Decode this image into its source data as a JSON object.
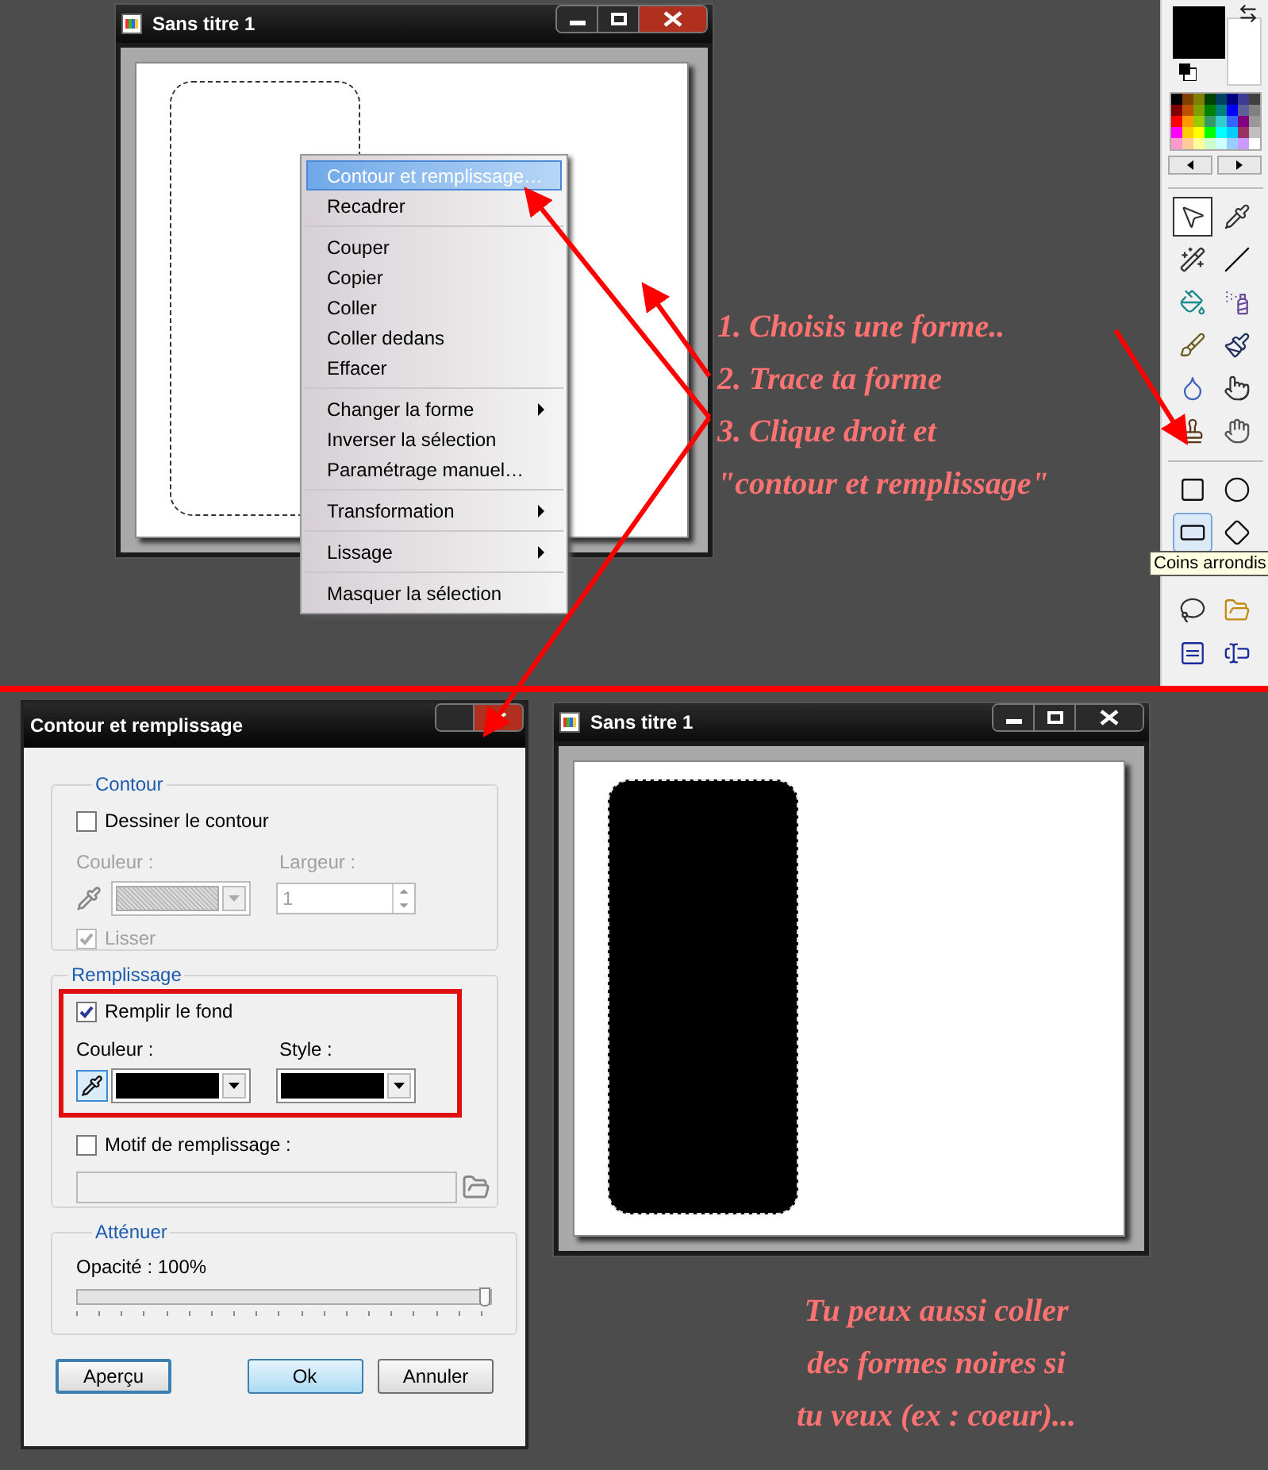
{
  "top_window": {
    "title": "Sans titre 1",
    "active": true,
    "selection_filled": false
  },
  "context_menu": [
    {
      "kind": "item",
      "label": "Contour et remplissage…",
      "selected": true,
      "submenu": false
    },
    {
      "kind": "item",
      "label": "Recadrer",
      "selected": false,
      "submenu": false
    },
    {
      "kind": "separator"
    },
    {
      "kind": "item",
      "label": "Couper",
      "selected": false,
      "submenu": false
    },
    {
      "kind": "item",
      "label": "Copier",
      "selected": false,
      "submenu": false
    },
    {
      "kind": "item",
      "label": "Coller",
      "selected": false,
      "submenu": false
    },
    {
      "kind": "item",
      "label": "Coller dedans",
      "selected": false,
      "submenu": false
    },
    {
      "kind": "item",
      "label": "Effacer",
      "selected": false,
      "submenu": false
    },
    {
      "kind": "separator"
    },
    {
      "kind": "item",
      "label": "Changer la forme",
      "selected": false,
      "submenu": true
    },
    {
      "kind": "item",
      "label": "Inverser la sélection",
      "selected": false,
      "submenu": false
    },
    {
      "kind": "item",
      "label": "Paramétrage manuel…",
      "selected": false,
      "submenu": false
    },
    {
      "kind": "separator"
    },
    {
      "kind": "item",
      "label": "Transformation",
      "selected": false,
      "submenu": true
    },
    {
      "kind": "separator"
    },
    {
      "kind": "item",
      "label": "Lissage",
      "selected": false,
      "submenu": true
    },
    {
      "kind": "separator"
    },
    {
      "kind": "item",
      "label": "Masquer la sélection",
      "selected": false,
      "submenu": false
    }
  ],
  "annotations": [
    "1. Choisis une forme..",
    "2. Trace ta forme",
    "3. Clique droit et",
    "\"contour et remplissage\""
  ],
  "toolbox": {
    "palette": [
      {
        "color": "#000000"
      },
      {
        "color": "#804000"
      },
      {
        "color": "#808000"
      },
      {
        "color": "#004000"
      },
      {
        "color": "#004060"
      },
      {
        "color": "#000080"
      },
      {
        "color": "#3c3c90"
      },
      {
        "color": "#404040"
      },
      {
        "color": "#800000"
      },
      {
        "color": "#c05000"
      },
      {
        "color": "#80a000"
      },
      {
        "color": "#008000"
      },
      {
        "color": "#008080"
      },
      {
        "color": "#0000ff"
      },
      {
        "color": "#606099"
      },
      {
        "color": "#808080"
      },
      {
        "color": "#ff0000"
      },
      {
        "color": "#ff9900"
      },
      {
        "color": "#99cc00"
      },
      {
        "color": "#339966"
      },
      {
        "color": "#33cccc"
      },
      {
        "color": "#3366ff"
      },
      {
        "color": "#800080"
      },
      {
        "color": "#999999"
      },
      {
        "color": "#ff00ff"
      },
      {
        "color": "#ffcc00"
      },
      {
        "color": "#ffff00"
      },
      {
        "color": "#00ff00"
      },
      {
        "color": "#00ffff"
      },
      {
        "color": "#00ccff"
      },
      {
        "color": "#993366"
      },
      {
        "color": "#c0c0c0"
      },
      {
        "color": "#ff99cc"
      },
      {
        "color": "#ffcc99"
      },
      {
        "color": "#ffff99"
      },
      {
        "color": "#ccffcc"
      },
      {
        "color": "#ccffff"
      },
      {
        "color": "#99ccff"
      },
      {
        "color": "#cc99ff"
      },
      {
        "color": "#ffffff"
      }
    ],
    "tools": [
      {
        "kind": "pointer",
        "selected": true
      },
      {
        "kind": "eyedropper",
        "selected": false
      },
      {
        "kind": "wand",
        "selected": false
      },
      {
        "kind": "line",
        "selected": false
      },
      {
        "kind": "bucket",
        "selected": false
      },
      {
        "kind": "spray",
        "selected": false
      },
      {
        "kind": "brush",
        "selected": false
      },
      {
        "kind": "brush2",
        "selected": false
      },
      {
        "kind": "drop",
        "selected": false
      },
      {
        "kind": "finger",
        "selected": false
      },
      {
        "kind": "stamp",
        "selected": false
      },
      {
        "kind": "hand",
        "selected": false
      }
    ],
    "shapes": [
      {
        "kind": "rectangle",
        "selected": false
      },
      {
        "kind": "ellipse",
        "selected": false
      },
      {
        "kind": "rounded",
        "selected": true
      },
      {
        "kind": "diamond",
        "selected": false
      },
      {
        "kind": "lasso",
        "selected": false
      },
      {
        "kind": "folder",
        "selected": false
      },
      {
        "kind": "select_h",
        "selected": false
      },
      {
        "kind": "select_i",
        "selected": false
      }
    ],
    "tooltip": "Coins arrondis"
  },
  "dialog": {
    "title": "Contour et remplissage",
    "contour": {
      "legend": "Contour",
      "disabled": true,
      "draw": {
        "label": "Dessiner le contour",
        "checked": false
      },
      "color_label": "Couleur :",
      "width_label": "Largeur :",
      "width_value": "1",
      "smooth": {
        "label": "Lisser",
        "checked": true
      }
    },
    "fill": {
      "legend": "Remplissage",
      "fill_bg": {
        "label": "Remplir le fond",
        "checked": true
      },
      "color_label": "Couleur :",
      "style_label": "Style :",
      "pattern": {
        "label": "Motif de remplissage :",
        "checked": false
      }
    },
    "fade": {
      "legend": "Atténuer",
      "opacity_label": "Opacité : 100%",
      "level": 1
    },
    "buttons": [
      {
        "label": "Aperçu",
        "default": false
      },
      {
        "label": "Ok",
        "default": true
      },
      {
        "label": "Annuler",
        "default": false
      }
    ]
  },
  "result_window": {
    "title": "Sans titre 1",
    "active": false,
    "selection_filled": true
  },
  "note": [
    "Tu peux aussi coller",
    "des formes noires si",
    "tu veux (ex : coeur)..."
  ]
}
